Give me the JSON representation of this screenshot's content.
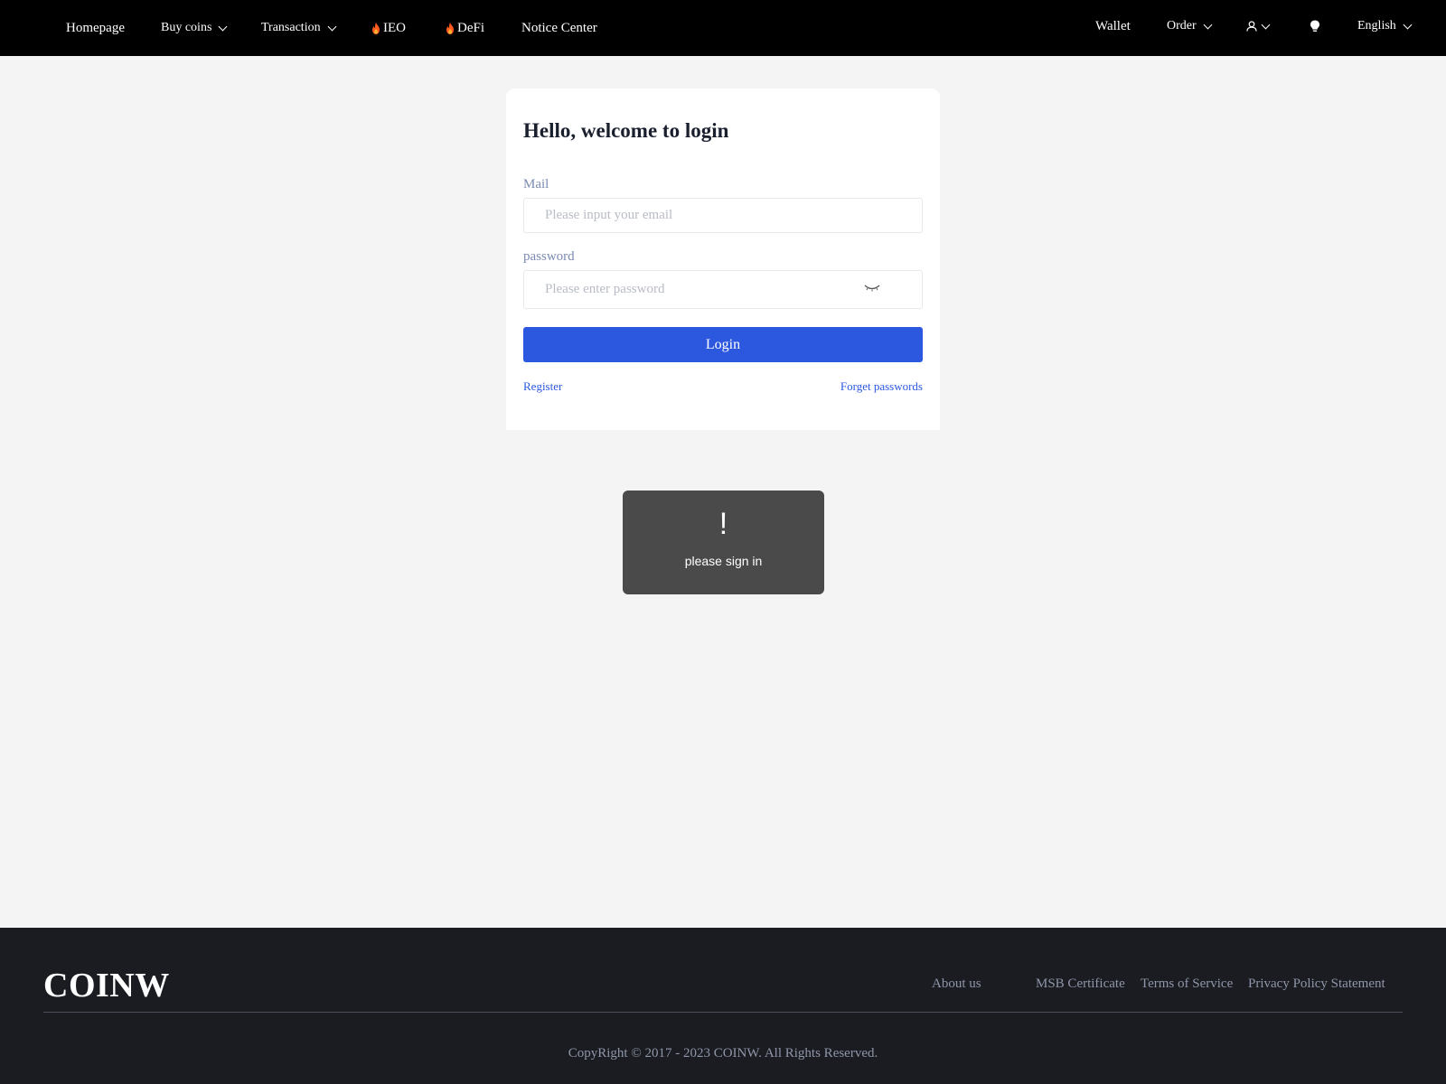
{
  "header": {
    "nav": {
      "homepage": "Homepage",
      "buy_coins": "Buy coins",
      "transaction": "Transaction",
      "ieo": "IEO",
      "defi": "DeFi",
      "notice": "Notice Center"
    },
    "right": {
      "wallet": "Wallet",
      "order": "Order",
      "user_icon": "user-icon",
      "theme_icon": "lightbulb-icon",
      "language": "English"
    }
  },
  "login": {
    "title": "Hello, welcome to login",
    "mail_label": "Mail",
    "mail_placeholder": "Please input your email",
    "password_label": "password",
    "password_placeholder": "Please enter password",
    "login_button": "Login",
    "register": "Register",
    "forget": "Forget passwords"
  },
  "toast": {
    "icon": "!",
    "message": "please sign in"
  },
  "footer": {
    "logo": "COINW",
    "links": {
      "about": "About us",
      "msb": "MSB Certificate",
      "terms": "Terms of Service",
      "privacy": "Privacy Policy Statement"
    },
    "copyright": "CopyRight © 2017 - 2023 COINW. All Rights Reserved."
  },
  "colors": {
    "accent": "#2c58e0",
    "header_bg": "#000000",
    "footer_bg": "#1a1c22",
    "page_bg": "#f4f4f4"
  }
}
